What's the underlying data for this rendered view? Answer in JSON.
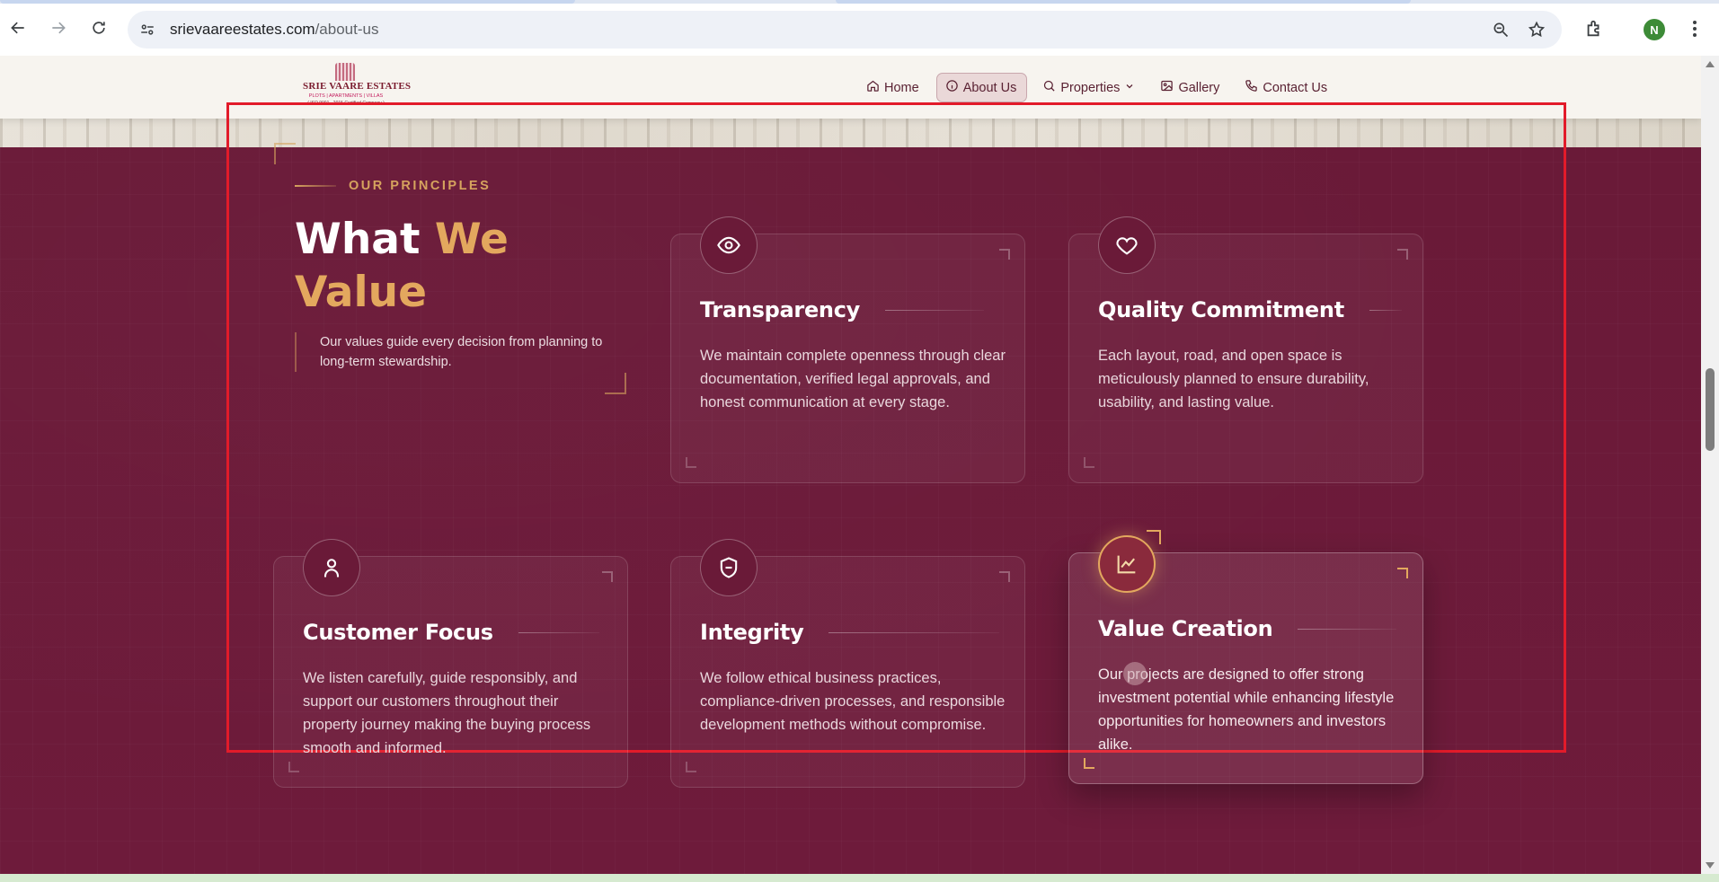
{
  "browser": {
    "url_domain": "srievaareestates.com",
    "url_path": "/about-us",
    "profile_initial": "N",
    "icons": [
      "back-icon",
      "forward-icon",
      "reload-icon",
      "site-info-icon",
      "zoom-icon",
      "bookmark-star-icon",
      "extensions-icon",
      "menu-icon"
    ]
  },
  "header": {
    "logo": {
      "brand": "SRIE VAARE ESTATES",
      "tagline": "PLOTS | APARTMENTS | VILLAS",
      "iso": "( ISO 9001 - 2015 Certified Company )"
    },
    "menu": [
      {
        "label": "Home",
        "icon": "home-icon"
      },
      {
        "label": "About Us",
        "icon": "info-icon",
        "active": true
      },
      {
        "label": "Properties",
        "icon": "search-icon",
        "has_dropdown": true
      },
      {
        "label": "Gallery",
        "icon": "image-icon"
      },
      {
        "label": "Contact Us",
        "icon": "phone-icon"
      }
    ]
  },
  "values_section": {
    "eyebrow": "OUR PRINCIPLES",
    "heading_white": "What",
    "heading_gold": "We Value",
    "description": "Our values guide every decision from planning to long-term stewardship.",
    "cards": [
      {
        "title": "Transparency",
        "icon": "eye-icon",
        "text": "We maintain complete openness through clear documentation, verified legal approvals, and honest communication at every stage."
      },
      {
        "title": "Quality Commitment",
        "icon": "heart-icon",
        "text": "Each layout, road, and open space is meticulously planned to ensure durability, usability, and lasting value."
      },
      {
        "title": "Customer Focus",
        "icon": "user-icon",
        "text": "We listen carefully, guide responsibly, and support our customers throughout their property journey making the buying process smooth and informed."
      },
      {
        "title": "Integrity",
        "icon": "shield-icon",
        "text": "We follow ethical business practices, compliance-driven processes, and responsible development methods without compromise."
      },
      {
        "title": "Value Creation",
        "icon": "trend-chart-icon",
        "text": "Our projects are designed to offer strong investment potential while enhancing lifestyle opportunities for homeowners and investors alike.",
        "highlighted": true
      }
    ]
  },
  "colors": {
    "section_bg": "#6e1b3b",
    "accent_gold": "#e3a85e",
    "highlight_frame": "#e21b2a"
  }
}
